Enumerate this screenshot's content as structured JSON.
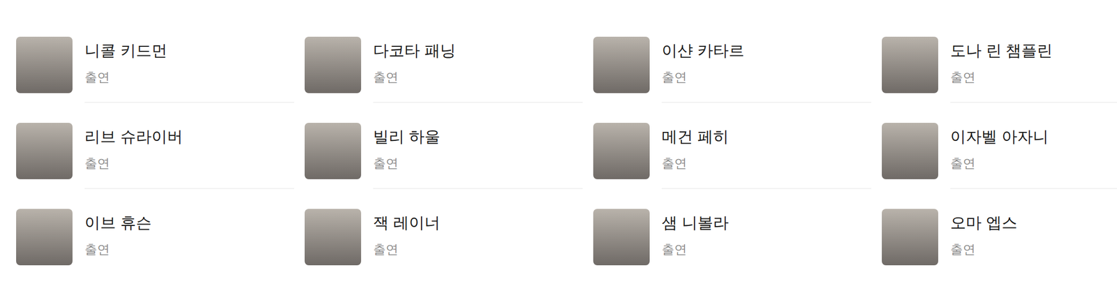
{
  "cast": [
    {
      "name": "니콜 키드먼",
      "role": "출연"
    },
    {
      "name": "다코타 패닝",
      "role": "출연"
    },
    {
      "name": "이샨 카타르",
      "role": "출연"
    },
    {
      "name": "도나 린 챔플린",
      "role": "출연"
    },
    {
      "name": "리브 슈라이버",
      "role": "출연"
    },
    {
      "name": "빌리 하울",
      "role": "출연"
    },
    {
      "name": "메건 페히",
      "role": "출연"
    },
    {
      "name": "이자벨 아자니",
      "role": "출연"
    },
    {
      "name": "이브 휴슨",
      "role": "출연"
    },
    {
      "name": "잭 레이너",
      "role": "출연"
    },
    {
      "name": "샘 니볼라",
      "role": "출연"
    },
    {
      "name": "오마 엡스",
      "role": "출연"
    }
  ]
}
